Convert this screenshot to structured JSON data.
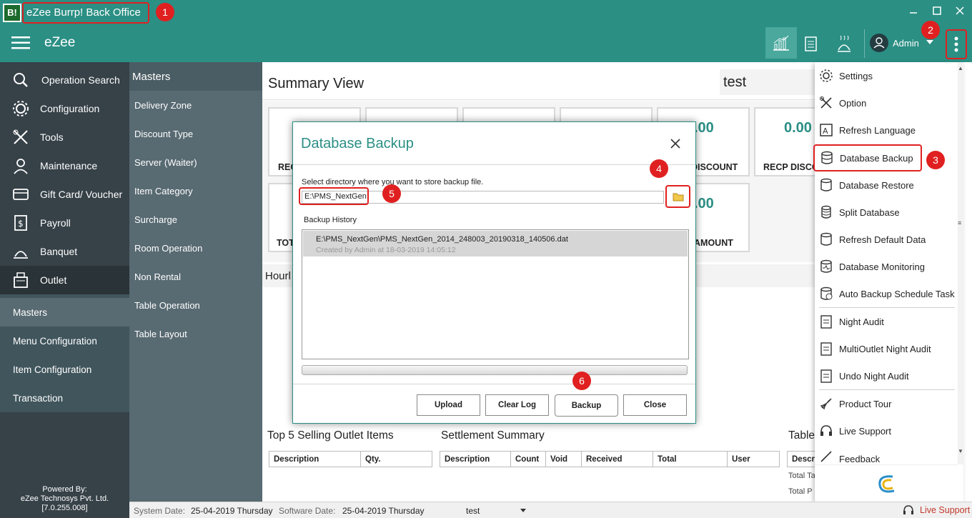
{
  "window": {
    "title": "eZee Burrp! Back Office",
    "logo_text": "B!"
  },
  "appbar": {
    "brand": "eZee",
    "user": "Admin"
  },
  "annotations": [
    "1",
    "2",
    "3",
    "4",
    "5",
    "6"
  ],
  "sidebar": {
    "items": [
      {
        "label": "Operation Search",
        "icon": "search-icon"
      },
      {
        "label": "Configuration",
        "icon": "gear-icon"
      },
      {
        "label": "Tools",
        "icon": "tools-icon"
      },
      {
        "label": "Maintenance",
        "icon": "maintenance-icon"
      },
      {
        "label": "Gift Card/ Voucher",
        "icon": "gift-card-icon"
      },
      {
        "label": "Payroll",
        "icon": "payroll-icon"
      },
      {
        "label": "Banquet",
        "icon": "banquet-icon"
      },
      {
        "label": "Outlet",
        "icon": "outlet-icon"
      }
    ],
    "sub_items": [
      "Masters",
      "Menu Configuration",
      "Item Configuration",
      "Transaction"
    ],
    "powered_by": "Powered By:",
    "company": "eZee Technosys Pvt. Ltd.",
    "version": "[7.0.255.008]"
  },
  "masters": {
    "title": "Masters",
    "items": [
      "Delivery Zone",
      "Discount Type",
      "Server (Waiter)",
      "Item Category",
      "Surcharge",
      "Room Operation",
      "Non Rental",
      "Table Operation",
      "Table Layout"
    ]
  },
  "main": {
    "title": "Summary View",
    "filter_value": "test",
    "cards_row1": [
      {
        "value": "",
        "label": "REC"
      },
      {
        "value": "",
        "label": ""
      },
      {
        "value": "",
        "label": ""
      },
      {
        "value": "",
        "label": ""
      },
      {
        "value": ".00",
        "label": "DISCOUNT"
      },
      {
        "value": "0.00",
        "label": "RECP DISCO"
      }
    ],
    "cards_row2": [
      {
        "value": "",
        "label": "TOT"
      },
      {
        "value": ".00",
        "label": "AMOUNT"
      }
    ],
    "hourly_label": "Hourl",
    "top5_title": "Top 5 Selling Outlet Items",
    "top5_columns": [
      "Description",
      "Qty."
    ],
    "settlement_title": "Settlement Summary",
    "settlement_columns": [
      "Description",
      "Count",
      "Void",
      "Received",
      "Total",
      "User"
    ],
    "table_title": "Table",
    "table_columns": [
      "Descri"
    ],
    "table_rows": [
      "Total Ta",
      "Total P"
    ]
  },
  "dialog": {
    "title": "Database Backup",
    "instruction": "Select directory where you want to store backup file.",
    "path_value": "E:\\PMS_NextGen",
    "history_label": "Backup History",
    "history": [
      {
        "file": "E:\\PMS_NextGen\\PMS_NextGen_2014_248003_20190318_140506.dat",
        "meta": "Created by Admin at 18-03-2019 14:05:12"
      }
    ],
    "buttons": {
      "upload": "Upload",
      "clear_log": "Clear Log",
      "backup": "Backup",
      "close": "Close"
    }
  },
  "right_menu": {
    "items": [
      {
        "label": "Settings",
        "icon": "settings-icon"
      },
      {
        "label": "Option",
        "icon": "option-icon"
      },
      {
        "label": "Refresh Language",
        "icon": "language-icon"
      },
      {
        "label": "Database Backup",
        "icon": "database-backup-icon"
      },
      {
        "label": "Database Restore",
        "icon": "database-restore-icon"
      },
      {
        "label": "Split Database",
        "icon": "split-database-icon"
      },
      {
        "label": "Refresh Default Data",
        "icon": "refresh-data-icon"
      },
      {
        "label": "Database Monitoring",
        "icon": "database-monitor-icon"
      },
      {
        "label": "Auto Backup Schedule Task",
        "icon": "auto-backup-icon"
      },
      {
        "label": "Night Audit",
        "icon": "night-audit-icon"
      },
      {
        "label": "MultiOutlet Night Audit",
        "icon": "multioutlet-audit-icon"
      },
      {
        "label": "Undo Night Audit",
        "icon": "undo-audit-icon"
      },
      {
        "label": "Product Tour",
        "icon": "rocket-icon"
      },
      {
        "label": "Live Support",
        "icon": "headset-icon"
      },
      {
        "label": "Feedback",
        "icon": "feedback-icon"
      }
    ]
  },
  "statusbar": {
    "system_date_label": "System Date:",
    "system_date": "25-04-2019 Thursday",
    "software_date_label": "Software Date:",
    "software_date": "25-04-2019 Thursday",
    "outlet": "test",
    "live_support": "Live Support"
  },
  "colors": {
    "teal": "#2b8f84",
    "sidebar": "#364148",
    "masters": "#586a72",
    "accent_red": "#e02020"
  }
}
